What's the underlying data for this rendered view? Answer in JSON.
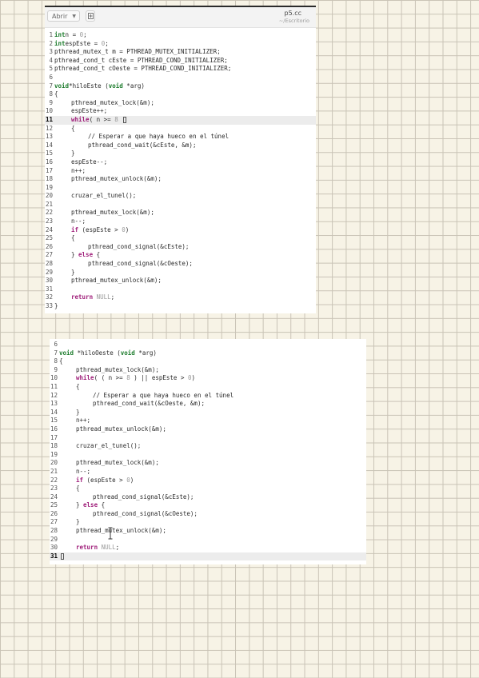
{
  "editor1": {
    "open_label": "Abrir",
    "file_title": "p5.cc",
    "file_path": "~/Escritorio",
    "lines": [
      {
        "n": "1",
        "i": 0,
        "tokens": [
          [
            "ty",
            "int"
          ],
          [
            "",
            "n = "
          ],
          [
            "num",
            "0"
          ],
          [
            "",
            ";"
          ]
        ]
      },
      {
        "n": "2",
        "i": 0,
        "tokens": [
          [
            "ty",
            "int"
          ],
          [
            "",
            "espEste = "
          ],
          [
            "num",
            "0"
          ],
          [
            "",
            ";"
          ]
        ]
      },
      {
        "n": "3",
        "i": 0,
        "tokens": [
          [
            "",
            "pthread_mutex_t m = PTHREAD_MUTEX_INITIALIZER;"
          ]
        ]
      },
      {
        "n": "4",
        "i": 0,
        "tokens": [
          [
            "",
            "pthread_cond_t cEste = PTHREAD_COND_INITIALIZER;"
          ]
        ]
      },
      {
        "n": "5",
        "i": 0,
        "tokens": [
          [
            "",
            "pthread_cond_t cOeste = PTHREAD_COND_INITIALIZER;"
          ]
        ]
      },
      {
        "n": "6",
        "i": 0,
        "tokens": []
      },
      {
        "n": "7",
        "i": 0,
        "tokens": [
          [
            "ty",
            "void"
          ],
          [
            "",
            "*hiloEste ("
          ],
          [
            "ty",
            "void"
          ],
          [
            "",
            " *arg)"
          ]
        ]
      },
      {
        "n": "8",
        "i": 0,
        "tokens": [
          [
            "",
            "{"
          ]
        ]
      },
      {
        "n": "9",
        "i": 2,
        "tokens": [
          [
            "",
            "pthread_mutex_lock(&m);"
          ]
        ]
      },
      {
        "n": "10",
        "i": 2,
        "tokens": [
          [
            "",
            "espEste++;"
          ]
        ]
      },
      {
        "n": "11",
        "i": 2,
        "current": true,
        "cursor": true,
        "tokens": [
          [
            "kw",
            "while"
          ],
          [
            "",
            "( n >= "
          ],
          [
            "num",
            "8"
          ],
          [
            "",
            " "
          ]
        ]
      },
      {
        "n": "12",
        "i": 2,
        "tokens": [
          [
            "",
            "{"
          ]
        ]
      },
      {
        "n": "13",
        "i": 4,
        "tokens": [
          [
            "",
            "// Esperar a que haya hueco en el túnel"
          ]
        ]
      },
      {
        "n": "14",
        "i": 4,
        "tokens": [
          [
            "",
            "pthread_cond_wait(&cEste, &m);"
          ]
        ]
      },
      {
        "n": "15",
        "i": 2,
        "tokens": [
          [
            "",
            "}"
          ]
        ]
      },
      {
        "n": "16",
        "i": 2,
        "tokens": [
          [
            "",
            "espEste--;"
          ]
        ]
      },
      {
        "n": "17",
        "i": 2,
        "tokens": [
          [
            "",
            "n++;"
          ]
        ]
      },
      {
        "n": "18",
        "i": 2,
        "tokens": [
          [
            "",
            "pthread_mutex_unlock(&m);"
          ]
        ]
      },
      {
        "n": "19",
        "i": 0,
        "tokens": []
      },
      {
        "n": "20",
        "i": 2,
        "tokens": [
          [
            "",
            "cruzar_el_tunel();"
          ]
        ]
      },
      {
        "n": "21",
        "i": 0,
        "tokens": []
      },
      {
        "n": "22",
        "i": 2,
        "tokens": [
          [
            "",
            "pthread_mutex_lock(&m);"
          ]
        ]
      },
      {
        "n": "23",
        "i": 2,
        "tokens": [
          [
            "",
            "n--;"
          ]
        ]
      },
      {
        "n": "24",
        "i": 2,
        "tokens": [
          [
            "kw",
            "if"
          ],
          [
            "",
            " (espEste > "
          ],
          [
            "num",
            "0"
          ],
          [
            "",
            ")"
          ]
        ]
      },
      {
        "n": "25",
        "i": 2,
        "tokens": [
          [
            "",
            "{"
          ]
        ]
      },
      {
        "n": "26",
        "i": 4,
        "tokens": [
          [
            "",
            "pthread_cond_signal(&cEste);"
          ]
        ]
      },
      {
        "n": "27",
        "i": 2,
        "tokens": [
          [
            "",
            "} "
          ],
          [
            "kw",
            "else"
          ],
          [
            "",
            " {"
          ]
        ]
      },
      {
        "n": "28",
        "i": 4,
        "tokens": [
          [
            "",
            "pthread_cond_signal(&cOeste);"
          ]
        ]
      },
      {
        "n": "29",
        "i": 2,
        "tokens": [
          [
            "",
            "}"
          ]
        ]
      },
      {
        "n": "30",
        "i": 2,
        "tokens": [
          [
            "",
            "pthread_mutex_unlock(&m);"
          ]
        ]
      },
      {
        "n": "31",
        "i": 0,
        "tokens": []
      },
      {
        "n": "32",
        "i": 2,
        "tokens": [
          [
            "kw",
            "return"
          ],
          [
            "",
            " "
          ],
          [
            "num",
            "NULL"
          ],
          [
            "",
            ";"
          ]
        ]
      },
      {
        "n": "33",
        "i": 0,
        "tokens": [
          [
            "",
            "}"
          ]
        ]
      }
    ]
  },
  "editor2": {
    "lines": [
      {
        "n": "6",
        "i": 0,
        "tokens": []
      },
      {
        "n": "7",
        "i": 0,
        "tokens": [
          [
            "ty",
            "void"
          ],
          [
            "",
            " *hiloOeste ("
          ],
          [
            "ty",
            "void"
          ],
          [
            "",
            " *arg)"
          ]
        ]
      },
      {
        "n": "8",
        "i": 0,
        "tokens": [
          [
            "",
            "{"
          ]
        ]
      },
      {
        "n": "9",
        "i": 2,
        "tokens": [
          [
            "",
            "pthread_mutex_lock(&m);"
          ]
        ]
      },
      {
        "n": "10",
        "i": 2,
        "tokens": [
          [
            "kw",
            "while"
          ],
          [
            "",
            "( ( n >= "
          ],
          [
            "num",
            "8"
          ],
          [
            "",
            " ) || espEste > "
          ],
          [
            "num",
            "0"
          ],
          [
            "",
            ")"
          ]
        ]
      },
      {
        "n": "11",
        "i": 2,
        "tokens": [
          [
            "",
            "{"
          ]
        ]
      },
      {
        "n": "12",
        "i": 4,
        "tokens": [
          [
            "",
            "// Esperar a que haya hueco en el túnel"
          ]
        ]
      },
      {
        "n": "13",
        "i": 4,
        "tokens": [
          [
            "",
            "pthread_cond_wait(&cOeste, &m);"
          ]
        ]
      },
      {
        "n": "14",
        "i": 2,
        "tokens": [
          [
            "",
            "}"
          ]
        ]
      },
      {
        "n": "15",
        "i": 2,
        "tokens": [
          [
            "",
            "n++;"
          ]
        ]
      },
      {
        "n": "16",
        "i": 2,
        "tokens": [
          [
            "",
            "pthread_mutex_unlock(&m);"
          ]
        ]
      },
      {
        "n": "17",
        "i": 0,
        "tokens": []
      },
      {
        "n": "18",
        "i": 2,
        "tokens": [
          [
            "",
            "cruzar_el_tunel();"
          ]
        ]
      },
      {
        "n": "19",
        "i": 0,
        "tokens": []
      },
      {
        "n": "20",
        "i": 2,
        "tokens": [
          [
            "",
            "pthread_mutex_lock(&m);"
          ]
        ]
      },
      {
        "n": "21",
        "i": 2,
        "tokens": [
          [
            "",
            "n--;"
          ]
        ]
      },
      {
        "n": "22",
        "i": 2,
        "tokens": [
          [
            "kw",
            "if"
          ],
          [
            "",
            " (espEste > "
          ],
          [
            "num",
            "0"
          ],
          [
            "",
            ")"
          ]
        ]
      },
      {
        "n": "23",
        "i": 2,
        "tokens": [
          [
            "",
            "{"
          ]
        ]
      },
      {
        "n": "24",
        "i": 4,
        "tokens": [
          [
            "",
            "pthread_cond_signal(&cEste);"
          ]
        ]
      },
      {
        "n": "25",
        "i": 2,
        "tokens": [
          [
            "",
            "} "
          ],
          [
            "kw",
            "else"
          ],
          [
            "",
            " {"
          ]
        ]
      },
      {
        "n": "26",
        "i": 4,
        "tokens": [
          [
            "",
            "pthread_cond_signal(&cOeste);"
          ]
        ]
      },
      {
        "n": "27",
        "i": 2,
        "tokens": [
          [
            "",
            "}"
          ]
        ]
      },
      {
        "n": "28",
        "i": 2,
        "tokens": [
          [
            "",
            "pthread_mutex_unlock(&m);"
          ]
        ]
      },
      {
        "n": "29",
        "i": 0,
        "tokens": []
      },
      {
        "n": "30",
        "i": 2,
        "tokens": [
          [
            "kw",
            "return"
          ],
          [
            "",
            " "
          ],
          [
            "num",
            "NULL"
          ],
          [
            "",
            ";"
          ]
        ]
      },
      {
        "n": "31",
        "i": 0,
        "current": true,
        "cursor": true,
        "tokens": []
      }
    ]
  },
  "icons": {
    "new_document": "new-document-icon",
    "dropdown": "chevron-down-icon",
    "text_cursor": "text-cursor-icon"
  },
  "colors": {
    "keyword": "#a0207b",
    "type": "#1a7a2a",
    "number": "#999999",
    "background_grid": "#c9c3b6",
    "paper": "#f7f3e6"
  }
}
